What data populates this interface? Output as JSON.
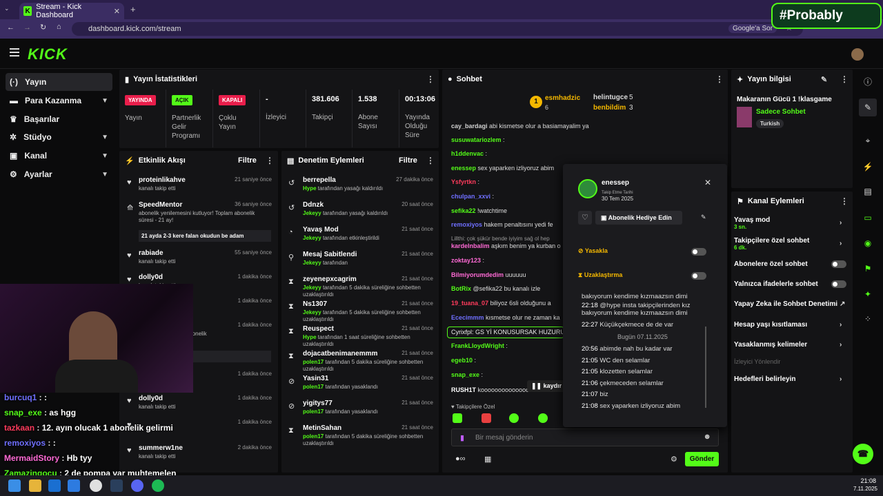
{
  "browser": {
    "tab_title": "Stream - Kick Dashboard",
    "url": "dashboard.kick.com/stream",
    "google_label": "Google'a Sor",
    "probably_label": "#Probably"
  },
  "nav": {
    "items": [
      {
        "label": "Yayın"
      },
      {
        "label": "Para Kazanma"
      },
      {
        "label": "Başarılar"
      },
      {
        "label": "Stüdyo"
      },
      {
        "label": "Kanal"
      },
      {
        "label": "Ayarlar"
      }
    ],
    "logo": "KICK"
  },
  "stats": {
    "title": "Yayın İstatistikleri",
    "cols": [
      {
        "badge": "YAYINDA",
        "label": "Yayın"
      },
      {
        "badge": "AÇIK",
        "label": "Partnerlik Gelir Programı"
      },
      {
        "badge": "KAPALI",
        "label": "Çoklu Yayın"
      },
      {
        "value": "-",
        "label": "İzleyici"
      },
      {
        "value": "381.606",
        "label": "Takipçi"
      },
      {
        "value": "1.538",
        "label": "Abone Sayısı"
      },
      {
        "value": "00:13:06",
        "label": "Yayında Olduğu Süre"
      }
    ]
  },
  "activity": {
    "title": "Etkinlik Akışı",
    "filter": "Filtre",
    "items": [
      {
        "name": "proteinlikahve",
        "sub": "kanalı takip etti",
        "time": "21 saniye önce"
      },
      {
        "name": "SpeedMentor",
        "sub": "abonelik yenilemesini kutluyor! Toplam abonelik süresi - 21 ay!",
        "time": "36 saniye önce",
        "msg": "21 ayda 2-3 kere falan okudun be adam"
      },
      {
        "name": "rabiade",
        "sub": "kanalı takip etti",
        "time": "55 saniye önce"
      },
      {
        "name": "dolly0d",
        "sub": "kanalı takip etti",
        "time": "1 dakika önce"
      },
      {
        "time": "1 dakika önce"
      },
      {
        "sub": "ni kutluyor! Toplam abonelik",
        "time": "1 dakika önce",
        "msg": "aaam"
      },
      {
        "time": "1 dakika önce"
      },
      {
        "name": "dolly0d",
        "sub": "kanalı takip etti",
        "time": "1 dakika önce"
      },
      {
        "time": "1 dakika önce"
      },
      {
        "name": "summerw1ne",
        "sub": "kanalı takip etti",
        "time": "2 dakika önce"
      }
    ]
  },
  "moderation": {
    "title": "Denetim Eylemleri",
    "filter": "Filtre",
    "items": [
      {
        "name": "berrepella",
        "who": "Hype",
        "sub": "tarafından yasağı kaldırıldı",
        "time": "27 dakika önce"
      },
      {
        "name": "Ddnzk",
        "who": "Jekeyy",
        "sub": "tarafından yasağı kaldırıldı",
        "time": "20 saat önce"
      },
      {
        "name": "Yavaş Mod",
        "who": "Jekeyy",
        "sub": "tarafından etkinleştirildi",
        "time": "21 saat önce"
      },
      {
        "name": "Mesaj Sabitlendi",
        "who": "Jekeyy",
        "sub": "tarafından",
        "time": "21 saat önce"
      },
      {
        "name": "zeyenepxcagrim",
        "who": "Jekeyy",
        "sub": "tarafından 5 dakika süreliğine sohbetten uzaklaştırıldı",
        "time": "21 saat önce"
      },
      {
        "name": "Ns1307",
        "who": "Jekeyy",
        "sub": "tarafından 5 dakika süreliğine sohbetten uzaklaştırıldı",
        "time": "21 saat önce"
      },
      {
        "name": "Reuspect",
        "who": "Hype",
        "sub": "tarafından 1 saat süreliğine sohbetten uzaklaştırıldı",
        "time": "21 saat önce"
      },
      {
        "name": "dojacatbenimanemmm",
        "who": "polen17",
        "sub": "tarafından 5 dakika süreliğine sohbetten uzaklaştırıldı",
        "time": "21 saat önce"
      },
      {
        "name": "Yasin31",
        "who": "polen17",
        "sub": "tarafından yasaklandı",
        "time": "21 saat önce"
      },
      {
        "name": "yigitys77",
        "who": "polen17",
        "sub": "tarafından yasaklandı",
        "time": "21 saat önce"
      },
      {
        "name": "MetinSahan",
        "who": "polen17",
        "sub": "tarafından 5 dakika süreliğine sohbetten uzaklaştırıldı",
        "time": "21 saat önce"
      }
    ]
  },
  "chat": {
    "title": "Sohbet",
    "leaders": [
      {
        "name": "esmhadzic",
        "count": "6"
      },
      {
        "name": "helintugce",
        "count": "5"
      },
      {
        "name": "benbildim",
        "count": "3"
      }
    ],
    "lines": [
      {
        "user": "cay_bardagi",
        "text": "abi kismetse olur a basiamayalim ya",
        "color": "#d1d1d1"
      },
      {
        "user": "susuwatariozlem",
        "text": ":",
        "color": "#53fc18"
      },
      {
        "user": "h1ddenvac",
        "text": ":",
        "color": "#53fc18"
      },
      {
        "user": "enessep",
        "text": "sex yaparken izliyoruz abim",
        "color": "#53fc18"
      },
      {
        "user": "Ysfyrtkn",
        "text": ":",
        "color": "#ff3b5c"
      },
      {
        "user": "chulpan_xxvi",
        "text": ":",
        "color": "#6f6fff"
      },
      {
        "user": "sefika22",
        "text": "!watchtime",
        "color": "#53fc18"
      },
      {
        "user": "remoxiyos",
        "text": "hakem penaltısını yedi fe",
        "color": "#6f6fff"
      },
      {
        "user": "kardeInbalim",
        "text": "aşkım benim ya kurban o",
        "color": "#ff6ad5"
      },
      {
        "user": "zoktay123",
        "text": ":",
        "color": "#ff6ad5"
      },
      {
        "user": "Bilmiyorumdedim",
        "text": "uuuuuu",
        "color": "#ff6ad5"
      },
      {
        "user": "BotRix",
        "text": "@sefika22 bu kanalı izle",
        "color": "#53fc18"
      },
      {
        "user": "19_tuana_07",
        "text": "biliyoz 6sli olduğunu a",
        "color": "#ff3b5c"
      },
      {
        "user": "Ececimmm",
        "text": "kısmetse olur ne zaman ka",
        "color": "#6f6fff"
      },
      {
        "user": "FrankLloydWright",
        "text": ":",
        "color": "#53fc18"
      },
      {
        "user": "egeb10",
        "text": ":",
        "color": "#53fc18"
      },
      {
        "user": "snap_exe",
        "text": ":",
        "color": "#53fc18"
      },
      {
        "user": "RUSH1T",
        "text": "koooooooooooooo",
        "color": "#ffffff"
      }
    ],
    "reply_note": "Lillthi: çok şükür bende iyiyim sağ ol hep",
    "pinned": "Cyrixfpl: GS Yİ KONUSURSAK HUZURU",
    "paused": "kaydır",
    "follower_only": "Takipçilere Özel",
    "input_placeholder": "Bir mesaj gönderin",
    "send": "Gönder"
  },
  "user_card": {
    "name": "enessep",
    "follow_label": "Takip Etme Tarihi",
    "follow_date": "30 Tem 2025",
    "gift": "Abonelik Hediye Edin",
    "ban": "Yasakla",
    "timeout": "Uzaklaştırma",
    "history": [
      {
        "time": "",
        "text": "bakıyorum kendime kızmaazsın dimi"
      },
      {
        "time": "22:18",
        "text": "@hype insta takipçilerinden kız bakıyorum kendime kızmaazsın dimi"
      },
      {
        "time": "22:27",
        "text": "Küçükçekmece de de var"
      },
      {
        "time": "",
        "text": "Bugün 07.11.2025"
      },
      {
        "time": "20:56",
        "text": "abimde nah bu kadar var"
      },
      {
        "time": "21:05",
        "text": "WC den selamlar"
      },
      {
        "time": "21:05",
        "text": "klozetten selamlar"
      },
      {
        "time": "21:06",
        "text": "çekmeceden selamlar"
      },
      {
        "time": "21:07",
        "text": "biz"
      },
      {
        "time": "21:08",
        "text": "sex yaparken izliyoruz abim"
      }
    ]
  },
  "stream_info": {
    "title": "Yayın bilgisi",
    "stream_title": "Makaranın Gücü 1 !klasgame",
    "category": "Sadece Sohbet",
    "tag": "Turkish"
  },
  "channel_actions": {
    "title": "Kanal Eylemleri",
    "items": [
      {
        "label": "Yavaş mod",
        "sub": "3 sn."
      },
      {
        "label": "Takipçilere özel sohbet",
        "sub": "6 dk."
      },
      {
        "label": "Abonelere özel sohbet"
      },
      {
        "label": "Yalnızca ifadelerle sohbet"
      },
      {
        "label": "Yapay Zeka ile Sohbet Denetimi"
      },
      {
        "label": "Hesap yaşı kısıtlaması"
      },
      {
        "label": "Yasaklanmış kelimeler"
      },
      {
        "label": "İzleyici Yönlendir"
      },
      {
        "label": "Hedefleri belirleyin"
      }
    ]
  },
  "overlay_chat": [
    {
      "user": "burcuq1",
      "text": ":",
      "color": "#6f6fff"
    },
    {
      "user": "snap_exe",
      "text": "as hgg",
      "color": "#53fc18"
    },
    {
      "user": "tazkaan",
      "text": "12. ayın olucak 1 abonelik gelirmi",
      "color": "#ff3b5c"
    },
    {
      "user": "remoxiyos",
      "text": ":",
      "color": "#6f6fff"
    },
    {
      "user": "MermaidStory",
      "text": "Hb tyy",
      "color": "#ff6ad5"
    },
    {
      "user": "Zamazingocu",
      "text": "2 de pompa var muhtemelen",
      "color": "#53fc18"
    }
  ],
  "taskbar": {
    "time": "21:08",
    "date": "7.11.2025"
  },
  "colors": {
    "accent": "#53fc18",
    "panel": "#141416",
    "bg": "#0b0b0c",
    "live": "#e91e4b"
  }
}
